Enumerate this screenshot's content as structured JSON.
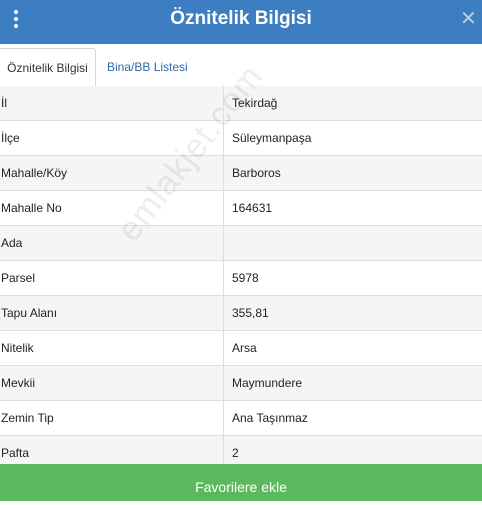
{
  "header": {
    "title": "Öznitelik Bilgisi",
    "close_glyph": "✕"
  },
  "tabs": [
    {
      "label": "Öznitelik Bilgisi",
      "active": true
    },
    {
      "label": "Bina/BB Listesi",
      "active": false
    }
  ],
  "rows": [
    {
      "key": "İl",
      "value": "Tekirdağ"
    },
    {
      "key": "İlçe",
      "value": "Süleymanpaşa"
    },
    {
      "key": "Mahalle/Köy",
      "value": "Barboros"
    },
    {
      "key": "Mahalle No",
      "value": "164631"
    },
    {
      "key": "Ada",
      "value": ""
    },
    {
      "key": "Parsel",
      "value": "5978"
    },
    {
      "key": "Tapu Alanı",
      "value": "355,81"
    },
    {
      "key": "Nitelik",
      "value": "Arsa"
    },
    {
      "key": "Mevkii",
      "value": "Maymundere"
    },
    {
      "key": "Zemin Tip",
      "value": "Ana Taşınmaz"
    },
    {
      "key": "Pafta",
      "value": "2"
    }
  ],
  "watermark": "emlakjet.com",
  "footer": {
    "button_label": "Favorilere ekle"
  },
  "colors": {
    "header": "#3d7ec2",
    "button": "#5cb85c",
    "tab_link": "#2a6ab0"
  }
}
